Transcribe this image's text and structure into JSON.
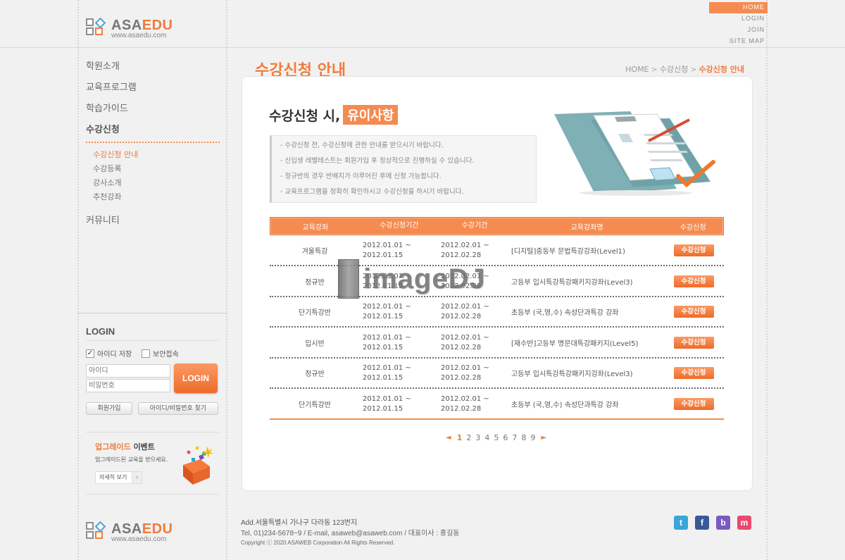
{
  "logo": {
    "main": "ASA",
    "accent": "EDU",
    "url": "www.asaedu.com"
  },
  "util_nav": [
    "HOME",
    "LOGIN",
    "JOIN",
    "SITE MAP"
  ],
  "sidebar": {
    "menu": [
      {
        "label": "학원소개"
      },
      {
        "label": "교육프로그램"
      },
      {
        "label": "학습가이드"
      },
      {
        "label": "수강신청"
      },
      {
        "label": "커뮤니티"
      }
    ],
    "submenu": [
      "수강신청 안내",
      "수강등록",
      "강사소개",
      "추천강좌"
    ]
  },
  "login": {
    "title": "LOGIN",
    "save_id": "아이디 저장",
    "secure": "보안접속",
    "id_placeholder": "아이디",
    "pw_placeholder": "비밀번호",
    "button": "LOGIN",
    "join": "회원가입",
    "find": "아이디/비밀번호 찾기"
  },
  "event": {
    "title_accent": "업그레이드",
    "title_rest": " 이벤트",
    "desc": "업그레이드된 교육을 받으세요.",
    "more": "자세히 보기",
    "more_icon": "+"
  },
  "page": {
    "title": "수강신청 안내",
    "breadcrumb": [
      "HOME",
      "수강신청",
      "수강신청 안내"
    ],
    "breadcrumb_sep": ">"
  },
  "notice": {
    "heading": "수강신청 시,",
    "highlight": "유이사항",
    "items": [
      "- 수강신청 전, 수강신청에 관한 안내를 받으시기 바랍니다.",
      "- 신입생 레벨테스트는 회원가입 후 정상적으로 진행하실 수 있습니다.",
      "- 정규반의 경우 반배치가 이루어진 후에 신청 가능합니다.",
      "- 교육프로그램을 정확히 확인하시고 수강신청을 하시기 바랍니다."
    ]
  },
  "table": {
    "headers": [
      "교육강좌",
      "수강신청기간",
      "수강기간",
      "교육강좌명",
      "수강신청"
    ],
    "rows": [
      {
        "course": "겨울특강",
        "apply_from": "2012.01.01 ~",
        "apply_to": "2012.01.15",
        "period_from": "2012.02.01 ~",
        "period_to": "2012.02.28",
        "name": "[디지털]중등부 문법특강강좌(Level1)",
        "button": "수강신청"
      },
      {
        "course": "정규반",
        "apply_from": "2012.01.01 ~",
        "apply_to": "2012.01.15",
        "period_from": "2012.02.01 ~",
        "period_to": "2012.02.28",
        "name": "고등부 입시특강특강패키지강좌(Level3)",
        "button": "수강신청"
      },
      {
        "course": "단기특강반",
        "apply_from": "2012.01.01 ~",
        "apply_to": "2012.01.15",
        "period_from": "2012.02.01 ~",
        "period_to": "2012.02.28",
        "name": "초등부 (국,영,수) 속성단과특강 강좌",
        "button": "수강신청"
      },
      {
        "course": "입시반",
        "apply_from": "2012.01.01 ~",
        "apply_to": "2012.01.15",
        "period_from": "2012.02.01 ~",
        "period_to": "2012.02.28",
        "name": "[재수반]고등부 명문대특강패키지(Level5)",
        "button": "수강신청"
      },
      {
        "course": "정규반",
        "apply_from": "2012.01.01 ~",
        "apply_to": "2012.01.15",
        "period_from": "2012.02.01 ~",
        "period_to": "2012.02.28",
        "name": "고등부 입시특강특강패키지강좌(Level3)",
        "button": "수강신청"
      },
      {
        "course": "단기특강반",
        "apply_from": "2012.01.01 ~",
        "apply_to": "2012.01.15",
        "period_from": "2012.02.01 ~",
        "period_to": "2012.02.28",
        "name": "초등부 (국,영,수) 속성단과특강 강좌",
        "button": "수강신청"
      }
    ]
  },
  "pagination": {
    "pages": [
      "1",
      "2",
      "3",
      "4",
      "5",
      "6",
      "7",
      "8",
      "9"
    ],
    "current": "1",
    "prev": "◄",
    "next": "►"
  },
  "footer": {
    "address": "Add.서울특별시 가나구 다라동 123번지",
    "contact": "Tel, 01)234-5678~9 / E-mail, asaweb@asaweb.com / 대표이사 : 홍길동",
    "copyright": "Copyright ⓒ 2020 ASAWEB Corporation All Rights Reserved."
  },
  "sns": [
    {
      "name": "twitter-icon",
      "glyph": "t",
      "color": "#3aa5d8"
    },
    {
      "name": "facebook-icon",
      "glyph": "f",
      "color": "#3b5998"
    },
    {
      "name": "blog-icon",
      "glyph": "b",
      "color": "#7b5bbf"
    },
    {
      "name": "me2day-icon",
      "glyph": "m",
      "color": "#e84a6f"
    }
  ],
  "watermark": "imageDJ",
  "colors": {
    "accent": "#f58b51",
    "accent_dark": "#f07b3c"
  }
}
